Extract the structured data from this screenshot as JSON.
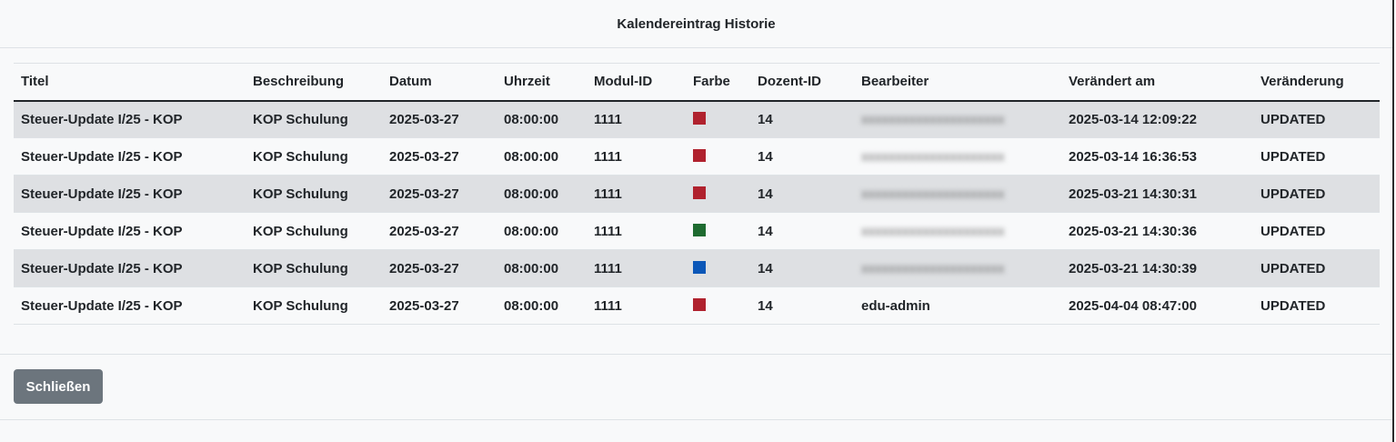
{
  "modal": {
    "title": "Kalendereintrag Historie",
    "close_label": "Schließen"
  },
  "table": {
    "headers": [
      "Titel",
      "Beschreibung",
      "Datum",
      "Uhrzeit",
      "Modul-ID",
      "Farbe",
      "Dozent-ID",
      "Bearbeiter",
      "Verändert am",
      "Veränderung"
    ],
    "rows": [
      {
        "titel": "Steuer-Update I/25 - KOP",
        "beschreibung": "KOP Schulung",
        "datum": "2025-03-27",
        "uhrzeit": "08:00:00",
        "modul_id": "1111",
        "farbe": "#b0222e",
        "dozent_id": "14",
        "bearbeiter": "",
        "bearbeiter_blurred": true,
        "veraendert_am": "2025-03-14 12:09:22",
        "veraenderung": "UPDATED"
      },
      {
        "titel": "Steuer-Update I/25 - KOP",
        "beschreibung": "KOP Schulung",
        "datum": "2025-03-27",
        "uhrzeit": "08:00:00",
        "modul_id": "1111",
        "farbe": "#b0222e",
        "dozent_id": "14",
        "bearbeiter": "",
        "bearbeiter_blurred": true,
        "veraendert_am": "2025-03-14 16:36:53",
        "veraenderung": "UPDATED"
      },
      {
        "titel": "Steuer-Update I/25 - KOP",
        "beschreibung": "KOP Schulung",
        "datum": "2025-03-27",
        "uhrzeit": "08:00:00",
        "modul_id": "1111",
        "farbe": "#b0222e",
        "dozent_id": "14",
        "bearbeiter": "",
        "bearbeiter_blurred": true,
        "veraendert_am": "2025-03-21 14:30:31",
        "veraenderung": "UPDATED"
      },
      {
        "titel": "Steuer-Update I/25 - KOP",
        "beschreibung": "KOP Schulung",
        "datum": "2025-03-27",
        "uhrzeit": "08:00:00",
        "modul_id": "1111",
        "farbe": "#1e6b30",
        "dozent_id": "14",
        "bearbeiter": "",
        "bearbeiter_blurred": true,
        "veraendert_am": "2025-03-21 14:30:36",
        "veraenderung": "UPDATED"
      },
      {
        "titel": "Steuer-Update I/25 - KOP",
        "beschreibung": "KOP Schulung",
        "datum": "2025-03-27",
        "uhrzeit": "08:00:00",
        "modul_id": "1111",
        "farbe": "#0b57b8",
        "dozent_id": "14",
        "bearbeiter": "",
        "bearbeiter_blurred": true,
        "veraendert_am": "2025-03-21 14:30:39",
        "veraenderung": "UPDATED"
      },
      {
        "titel": "Steuer-Update I/25 - KOP",
        "beschreibung": "KOP Schulung",
        "datum": "2025-03-27",
        "uhrzeit": "08:00:00",
        "modul_id": "1111",
        "farbe": "#b0222e",
        "dozent_id": "14",
        "bearbeiter": "edu-admin",
        "bearbeiter_blurred": false,
        "veraendert_am": "2025-04-04 08:47:00",
        "veraenderung": "UPDATED"
      }
    ]
  }
}
